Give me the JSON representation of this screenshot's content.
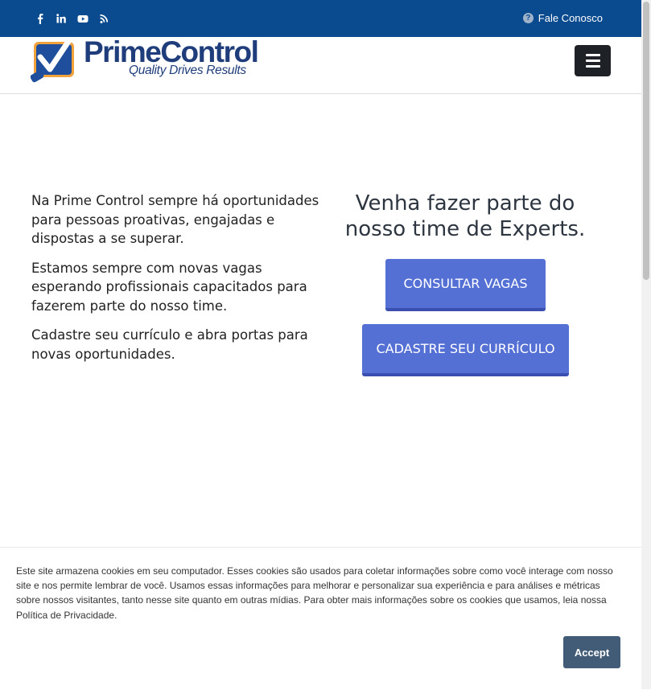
{
  "topbar": {
    "social_icons": [
      "facebook-icon",
      "linkedin-icon",
      "youtube-icon",
      "rss-icon"
    ],
    "contact_label": "Fale Conosco"
  },
  "header": {
    "brand": "PrimeControl",
    "tagline": "Quality Drives Results"
  },
  "main": {
    "paragraphs": [
      "Na Prime Control sempre há oportunidades para pessoas proativas, engajadas e dispostas a se superar.",
      "Estamos sempre com novas vagas esperando profissionais capacitados para fazerem parte do nosso time.",
      "Cadastre seu currículo e abra portas para novas oportunidades."
    ],
    "headline": "Venha fazer parte do nosso time de Experts.",
    "btn_vagas": "CONSULTAR VAGAS",
    "btn_curriculo": "CADASTRE SEU CURRÍCULO"
  },
  "cookie": {
    "text": "Este site armazena cookies em seu computador. Esses cookies são usados para coletar informações sobre como você interage com nosso site e nos permite lembrar de você. Usamos essas informações para melhorar e personalizar sua experiência e para análises e métricas sobre nossos visitantes, tanto nesse site quanto em outras mídias. Para obter mais informações sobre os cookies que usamos, leia nossa Política de Privacidade.",
    "accept_label": "Accept"
  },
  "colors": {
    "topbar": "#0a4a8e",
    "button": "#5570d4",
    "accept": "#425b76"
  }
}
